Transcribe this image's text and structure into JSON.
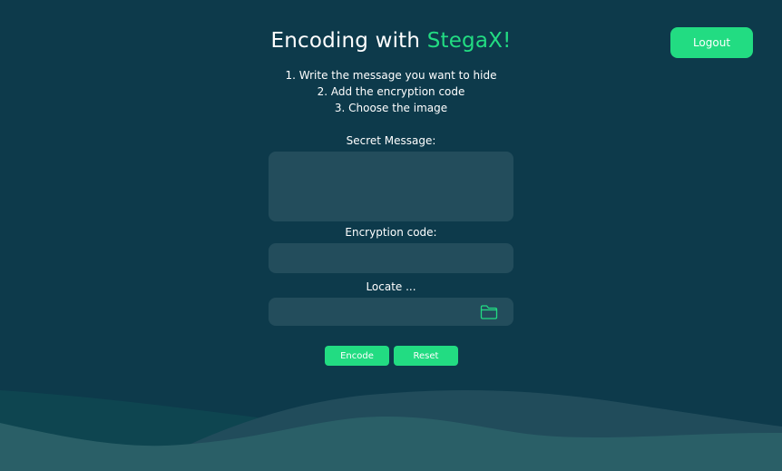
{
  "header": {
    "title_prefix": "Encoding with ",
    "title_brand": "StegaX!",
    "logout_label": "Logout"
  },
  "instructions": [
    "1. Write the message you want to hide",
    "2. Add the encryption code",
    "3. Choose the image"
  ],
  "form": {
    "secret_message_label": "Secret Message:",
    "secret_message_value": "",
    "encryption_code_label": "Encryption code:",
    "encryption_code_value": "",
    "locate_label": "Locate ...",
    "locate_icon": "folder-icon",
    "encode_label": "Encode",
    "reset_label": "Reset"
  },
  "colors": {
    "background": "#0d3a4b",
    "accent": "#22dc82",
    "field": "#234d5c",
    "wave_back": "#0e4550",
    "wave_mid": "#214c5b",
    "wave_front": "#2a5f67"
  }
}
